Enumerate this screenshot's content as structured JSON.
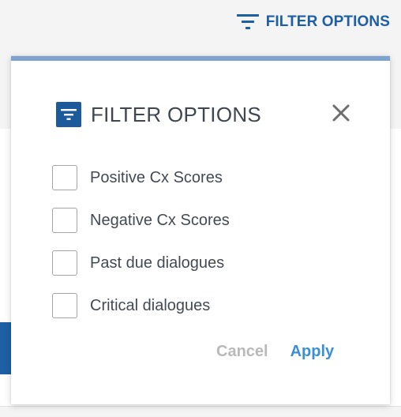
{
  "colors": {
    "accent": "#1e5fa3",
    "apply": "#3a8fd6",
    "icon_bg": "#1d5a9c"
  },
  "trigger": {
    "icon": "filter-lines-icon",
    "label": "FILTER OPTIONS"
  },
  "panel": {
    "icon": "filter-lines-icon",
    "title": "FILTER OPTIONS",
    "close_icon": "close-icon",
    "options": [
      {
        "label": "Positive Cx Scores",
        "checked": false
      },
      {
        "label": "Negative Cx Scores",
        "checked": false
      },
      {
        "label": "Past due dialogues",
        "checked": false
      },
      {
        "label": "Critical dialogues",
        "checked": false
      }
    ],
    "cancel_label": "Cancel",
    "apply_label": "Apply"
  }
}
